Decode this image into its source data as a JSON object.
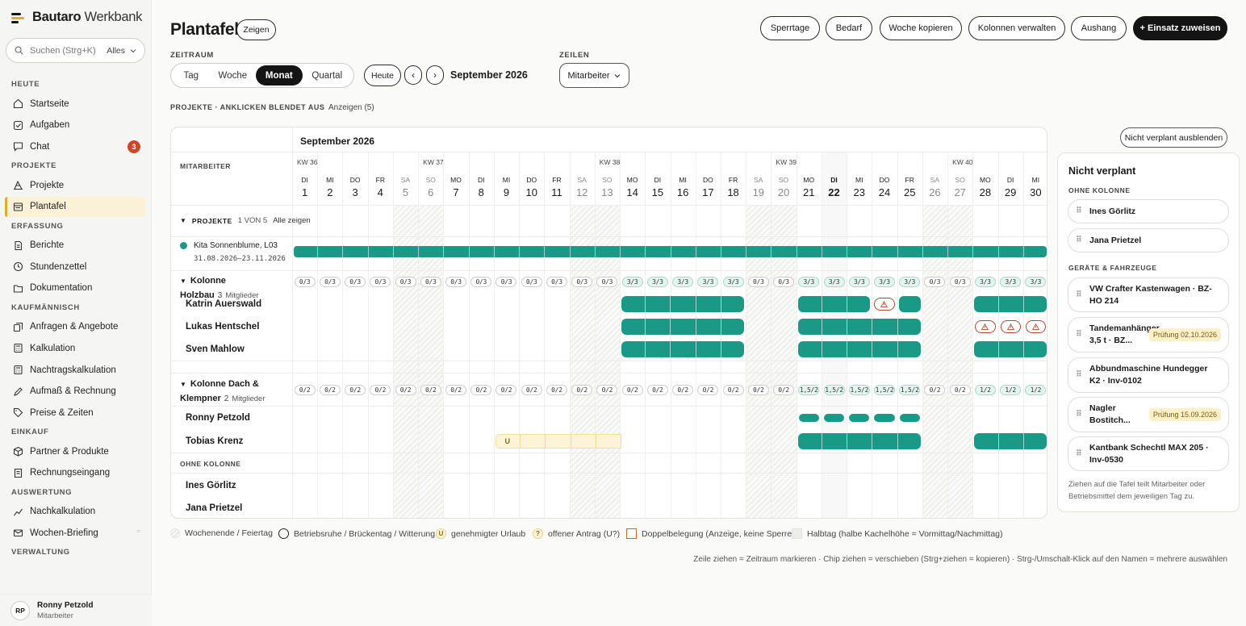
{
  "app": {
    "brand_bold": "Bautaro",
    "brand_rest": " Werkbank"
  },
  "search": {
    "placeholder": "Suchen (Strg+K)",
    "scope": "Alles"
  },
  "sidebar": {
    "sections": [
      {
        "label": "HEUTE",
        "items": [
          {
            "label": "Startseite",
            "icon": "home-icon"
          },
          {
            "label": "Aufgaben",
            "icon": "checkbox-icon"
          },
          {
            "label": "Chat",
            "icon": "chat-icon",
            "badge": "3"
          }
        ]
      },
      {
        "label": "PROJEKTE",
        "items": [
          {
            "label": "Projekte",
            "icon": "crane-icon"
          },
          {
            "label": "Plantafel",
            "icon": "board-icon",
            "active": true
          }
        ]
      },
      {
        "label": "ERFASSUNG",
        "items": [
          {
            "label": "Berichte",
            "icon": "document-icon"
          },
          {
            "label": "Stundenzettel",
            "icon": "clock-icon"
          },
          {
            "label": "Dokumentation",
            "icon": "folder-icon"
          }
        ]
      },
      {
        "label": "KAUFMÄNNISCH",
        "items": [
          {
            "label": "Anfragen & Angebote",
            "icon": "copy-icon"
          },
          {
            "label": "Kalkulation",
            "icon": "calculator-icon"
          },
          {
            "label": "Nachtragskalkulation",
            "icon": "calculator-icon"
          },
          {
            "label": "Aufmaß & Rechnung",
            "icon": "pen-icon"
          },
          {
            "label": "Preise & Zeiten",
            "icon": "tag-icon"
          }
        ]
      },
      {
        "label": "EINKAUF",
        "items": [
          {
            "label": "Partner & Produkte",
            "icon": "box-icon"
          },
          {
            "label": "Rechnungseingang",
            "icon": "receipt-icon"
          }
        ]
      },
      {
        "label": "AUSWERTUNG",
        "items": [
          {
            "label": "Nachkalkulation",
            "icon": "chart-icon"
          },
          {
            "label": "Wochen-Briefing",
            "icon": "mail-icon",
            "dot": "○"
          }
        ]
      },
      {
        "label": "VERWALTUNG",
        "items": []
      }
    ]
  },
  "user": {
    "initials": "RP",
    "name": "Ronny Petzold",
    "role": "Mitarbeiter"
  },
  "header": {
    "title": "Plantafel",
    "show_label": "Zeigen",
    "buttons": [
      "Sperrtage",
      "Bedarf",
      "Woche kopieren",
      "Kolonnen verwalten",
      "Aushang"
    ],
    "primary": "+ Einsatz zuweisen"
  },
  "controls": {
    "zeitraum_label": "ZEITRAUM",
    "views": [
      "Tag",
      "Woche",
      "Monat",
      "Quartal"
    ],
    "active_view": "Monat",
    "today": "Heute",
    "prev": "‹",
    "next": "›",
    "period": "September 2026",
    "zeilen_label": "ZEILEN",
    "zeilen_value": "Mitarbeiter"
  },
  "projects_filter": {
    "label": "PROJEKTE · ANKLICKEN BLENDET AUS",
    "show": "Anzeigen (5)"
  },
  "board": {
    "month": "September 2026",
    "employee_header": "MITARBEITER",
    "weeks": [
      {
        "label": "KW 36",
        "start": 1
      },
      {
        "label": "KW 37",
        "start": 6
      },
      {
        "label": "KW 38",
        "start": 13
      },
      {
        "label": "KW 39",
        "start": 20
      },
      {
        "label": "KW 40",
        "start": 27
      }
    ],
    "days": [
      {
        "d": "DI",
        "n": "1"
      },
      {
        "d": "MI",
        "n": "2"
      },
      {
        "d": "DO",
        "n": "3"
      },
      {
        "d": "FR",
        "n": "4"
      },
      {
        "d": "SA",
        "n": "5",
        "we": true
      },
      {
        "d": "SO",
        "n": "6",
        "we": true
      },
      {
        "d": "MO",
        "n": "7"
      },
      {
        "d": "DI",
        "n": "8"
      },
      {
        "d": "MI",
        "n": "9"
      },
      {
        "d": "DO",
        "n": "10"
      },
      {
        "d": "FR",
        "n": "11"
      },
      {
        "d": "SA",
        "n": "12",
        "we": true
      },
      {
        "d": "SO",
        "n": "13",
        "we": true
      },
      {
        "d": "MO",
        "n": "14"
      },
      {
        "d": "DI",
        "n": "15"
      },
      {
        "d": "MI",
        "n": "16"
      },
      {
        "d": "DO",
        "n": "17"
      },
      {
        "d": "FR",
        "n": "18"
      },
      {
        "d": "SA",
        "n": "19",
        "we": true
      },
      {
        "d": "SO",
        "n": "20",
        "we": true
      },
      {
        "d": "MO",
        "n": "21"
      },
      {
        "d": "DI",
        "n": "22",
        "today": true
      },
      {
        "d": "MI",
        "n": "23"
      },
      {
        "d": "DO",
        "n": "24"
      },
      {
        "d": "FR",
        "n": "25"
      },
      {
        "d": "SA",
        "n": "26",
        "we": true
      },
      {
        "d": "SO",
        "n": "27",
        "we": true
      },
      {
        "d": "MO",
        "n": "28"
      },
      {
        "d": "DI",
        "n": "29"
      },
      {
        "d": "MI",
        "n": "30"
      }
    ],
    "projects_row": {
      "toggle": "▼",
      "label": "PROJEKTE",
      "count": "1 VON 5",
      "show_all": "Alle zeigen"
    },
    "project": {
      "name": "Kita Sonnenblume, L03",
      "dates": "31.08.2026–23.11.2026",
      "color": "#1a9a86"
    },
    "groups": [
      {
        "name": "Kolonne Holzbau",
        "count": "3",
        "members_label": "Mitglieder",
        "capacity": [
          "0/3",
          "0/3",
          "0/3",
          "0/3",
          "0/3",
          "0/3",
          "0/3",
          "0/3",
          "0/3",
          "0/3",
          "0/3",
          "0/3",
          "0/3",
          "3/3",
          "3/3",
          "3/3",
          "3/3",
          "3/3",
          "0/3",
          "0/3",
          "3/3",
          "3/3",
          "3/3",
          "3/3",
          "3/3",
          "0/3",
          "0/3",
          "3/3",
          "3/3",
          "3/3"
        ],
        "members": [
          {
            "name": "Katrin Auerswald",
            "bars": [
              [
                14,
                18
              ],
              [
                21,
                23
              ],
              [
                25,
                25
              ],
              [
                28,
                30
              ]
            ],
            "warn": [
              24
            ]
          },
          {
            "name": "Lukas Hentschel",
            "bars": [
              [
                14,
                18
              ],
              [
                21,
                25
              ]
            ],
            "warn": [
              28,
              29,
              30
            ]
          },
          {
            "name": "Sven Mahlow",
            "bars": [
              [
                14,
                18
              ],
              [
                21,
                25
              ],
              [
                28,
                30
              ]
            ],
            "warn": []
          }
        ]
      },
      {
        "name": "Kolonne Dach & Klempner",
        "count": "2",
        "members_label": "Mitglieder",
        "capacity": [
          "0/2",
          "0/2",
          "0/2",
          "0/2",
          "0/2",
          "0/2",
          "0/2",
          "0/2",
          "0/2",
          "0/2",
          "0/2",
          "0/2",
          "0/2",
          "0/2",
          "0/2",
          "0/2",
          "0/2",
          "0/2",
          "0/2",
          "0/2",
          "1,5/2",
          "1,5/2",
          "1,5/2",
          "1,5/2",
          "1,5/2",
          "0/2",
          "0/2",
          "1/2",
          "1/2",
          "1/2"
        ],
        "members": [
          {
            "name": "Ronny Petzold",
            "half": [
              21,
              22,
              23,
              24,
              25
            ]
          },
          {
            "name": "Tobias Krenz",
            "bars": [
              [
                21,
                25
              ],
              [
                28,
                30
              ]
            ],
            "vacation": [
              9,
              13
            ],
            "vacation_label": "U"
          }
        ]
      }
    ],
    "ungrouped_label": "OHNE KOLONNE",
    "ungrouped": [
      "Ines Görlitz",
      "Jana Prietzel"
    ]
  },
  "unplanned": {
    "hide_button": "Nicht verplant ausblenden",
    "title": "Nicht verplant",
    "section1": "OHNE KOLONNE",
    "people": [
      "Ines Görlitz",
      "Jana Prietzel"
    ],
    "section2": "GERÄTE & FAHRZEUGE",
    "equipment": [
      {
        "name": "VW Crafter Kastenwagen · BZ-HO 214"
      },
      {
        "name": "Tandemanhänger 3,5 t · BZ...",
        "tag": "Prüfung 02.10.2026"
      },
      {
        "name": "Abbundmaschine Hundegger K2 · Inv-0102"
      },
      {
        "name": "Nagler Bostitch...",
        "tag": "Prüfung 15.09.2026"
      },
      {
        "name": "Kantbank Schechtl MAX 205 · Inv-0530"
      }
    ],
    "footer": "Ziehen auf die Tafel teilt Mitarbeiter oder Betriebsmittel dem jeweiligen Tag zu."
  },
  "legend": [
    {
      "label": "Wochenende / Feiertag",
      "kind": "weekend"
    },
    {
      "label": "Betriebsruhe / Brückentag / Witterung",
      "kind": "ring"
    },
    {
      "label": "genehmigter Urlaub",
      "kind": "vac",
      "glyph": "U"
    },
    {
      "label": "offener Antrag (U?)",
      "kind": "req",
      "glyph": "?"
    },
    {
      "label": "Doppelbelegung (Anzeige, keine Sperre)",
      "kind": "double"
    },
    {
      "label": "Halbtag (halbe Kachelhöhe = Vormittag/Nachmittag)",
      "kind": "half"
    }
  ],
  "hint": "Zeile ziehen = Zeitraum markieren · Chip ziehen = verschieben (Strg+ziehen = kopieren) · Strg-/Umschalt-Klick auf den Namen = mehrere auswählen",
  "colors": {
    "accent": "#1a9a86",
    "warn": "#b5482e",
    "vacation": "#fdf3d6",
    "active_nav": "#fbf1d6"
  }
}
